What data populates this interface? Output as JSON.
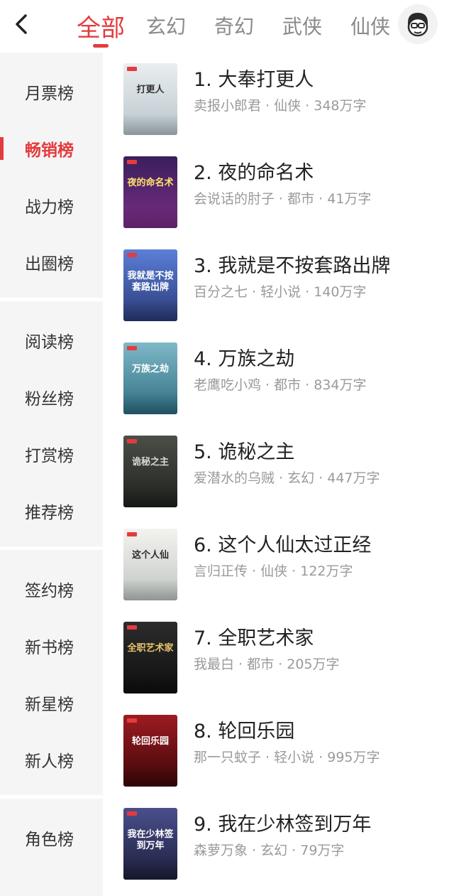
{
  "header": {
    "tabs": [
      {
        "label": "全部",
        "active": true
      },
      {
        "label": "玄幻",
        "active": false
      },
      {
        "label": "奇幻",
        "active": false
      },
      {
        "label": "武侠",
        "active": false
      },
      {
        "label": "仙侠",
        "active": false
      }
    ],
    "back_icon": "chevron-left-icon",
    "avatar_icon": "user-avatar-icon"
  },
  "sidebar": {
    "groups": [
      [
        "月票榜",
        "畅销榜",
        "战力榜",
        "出圈榜"
      ],
      [
        "阅读榜",
        "粉丝榜",
        "打赏榜",
        "推荐榜"
      ],
      [
        "签约榜",
        "新书榜",
        "新星榜",
        "新人榜"
      ],
      [
        "角色榜"
      ]
    ],
    "active": "畅销榜"
  },
  "books": [
    {
      "title": "1. 大奉打更人",
      "meta": "卖报小郎君 · 仙侠 · 348万字",
      "cover_text": "打更人",
      "cover_colors": [
        "#e9eef0",
        "#b9c6cc"
      ],
      "cover_text_color": "#333333"
    },
    {
      "title": "2. 夜的命名术",
      "meta": "会说话的肘子 · 都市 · 41万字",
      "cover_text": "夜的命名术",
      "cover_colors": [
        "#3a1f5c",
        "#7a2d86"
      ],
      "cover_text_color": "#ffe36b"
    },
    {
      "title": "3. 我就是不按套路出牌",
      "meta": "百分之七 · 轻小说 · 140万字",
      "cover_text": "我就是不按套路出牌",
      "cover_colors": [
        "#5b7fd8",
        "#2b3b78"
      ],
      "cover_text_color": "#ffffff"
    },
    {
      "title": "4. 万族之劫",
      "meta": "老鹰吃小鸡 · 都市 · 834万字",
      "cover_text": "万族之劫",
      "cover_colors": [
        "#7fb9c8",
        "#2c6c80"
      ],
      "cover_text_color": "#ffffff"
    },
    {
      "title": "5. 诡秘之主",
      "meta": "爱潜水的乌贼 · 玄幻 · 447万字",
      "cover_text": "诡秘之主",
      "cover_colors": [
        "#4b4f48",
        "#1e211d"
      ],
      "cover_text_color": "#d8d8d8"
    },
    {
      "title": "6. 这个人仙太过正经",
      "meta": "言归正传 · 仙侠 · 122万字",
      "cover_text": "这个人仙",
      "cover_colors": [
        "#f4f3ee",
        "#bfc6c4"
      ],
      "cover_text_color": "#2b2b2b"
    },
    {
      "title": "7. 全职艺术家",
      "meta": "我最白 · 都市 · 205万字",
      "cover_text": "全职艺术家",
      "cover_colors": [
        "#2c2c2c",
        "#0e0e0e"
      ],
      "cover_text_color": "#e6c46b"
    },
    {
      "title": "8. 轮回乐园",
      "meta": "那一只蚊子 · 轻小说 · 995万字",
      "cover_text": "轮回乐园",
      "cover_colors": [
        "#9c1c22",
        "#3d0608"
      ],
      "cover_text_color": "#ffffff"
    },
    {
      "title": "9. 我在少林签到万年",
      "meta": "森萝万象 · 玄幻 · 79万字",
      "cover_text": "我在少林签到万年",
      "cover_colors": [
        "#4a4f8c",
        "#1c1f3b"
      ],
      "cover_text_color": "#ffffff"
    }
  ],
  "colors": {
    "accent": "#e43b3f",
    "sidebar_bg": "#f5f5f5",
    "meta_text": "#9a9a9a"
  }
}
